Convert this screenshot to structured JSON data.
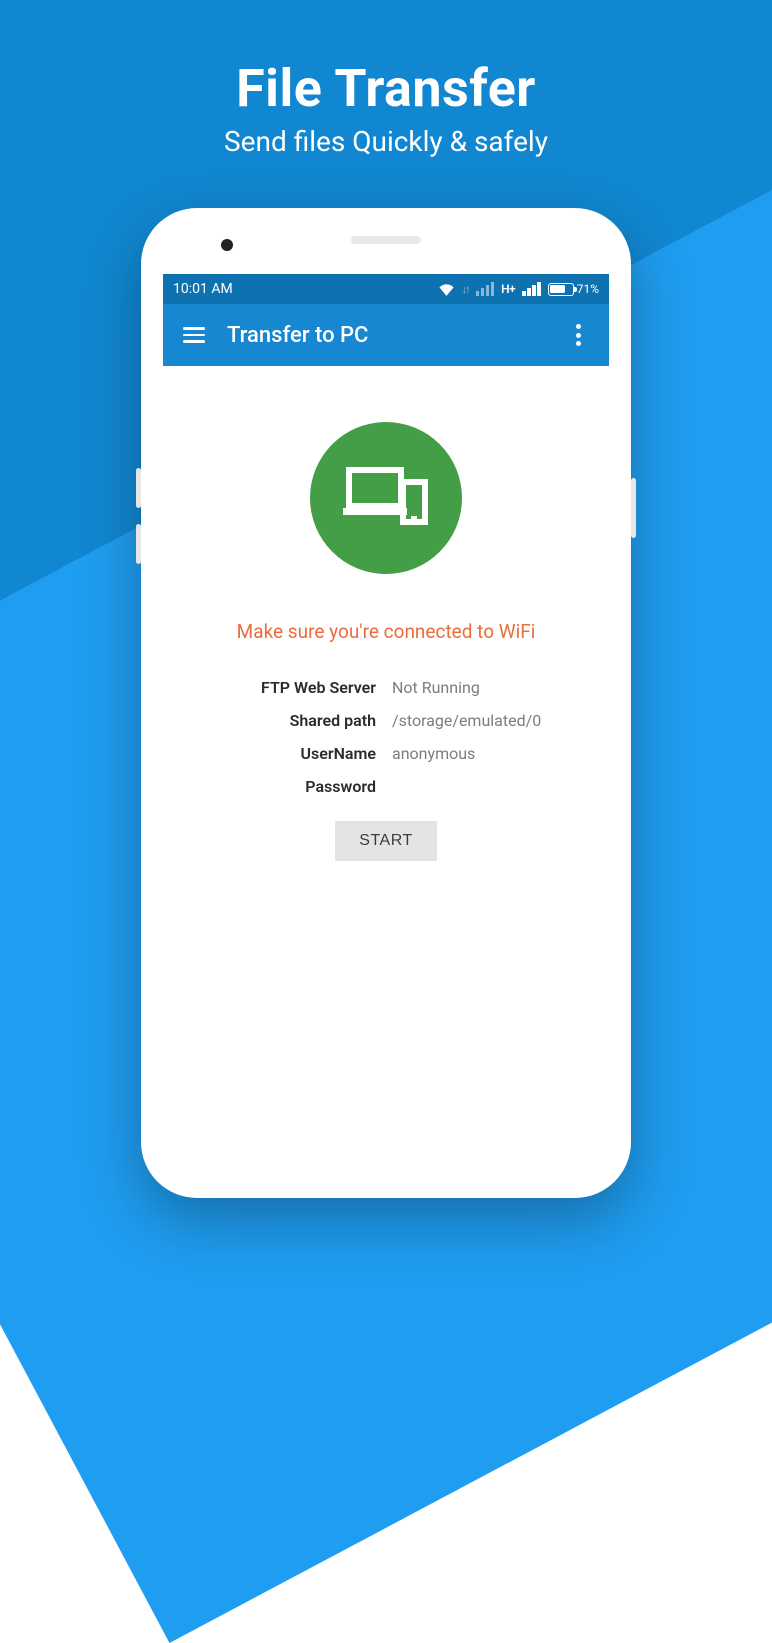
{
  "promo": {
    "title": "File Transfer",
    "subtitle": "Send files Quickly & safely"
  },
  "statusbar": {
    "time": "10:01 AM",
    "network_label": "H+",
    "battery_pct_text": "71%",
    "battery_fill_pct": 71
  },
  "appbar": {
    "title": "Transfer to PC"
  },
  "warning_text": "Make sure you're connected to WiFi",
  "fields": {
    "ftp_label": "FTP Web Server",
    "ftp_value": "Not Running",
    "path_label": "Shared path",
    "path_value": "/storage/emulated/0",
    "user_label": "UserName",
    "user_value": "anonymous",
    "pass_label": "Password",
    "pass_value": ""
  },
  "start_button_label": "START"
}
